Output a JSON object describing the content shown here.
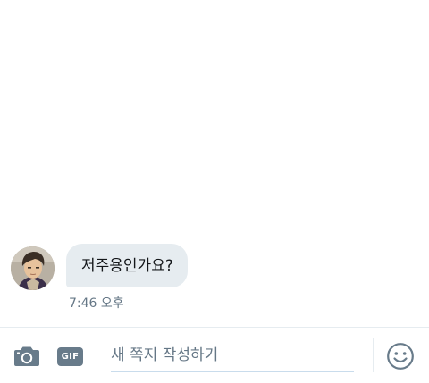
{
  "conversation": {
    "messages": [
      {
        "sender": "other",
        "text": "저주용인가요?",
        "time": "7:46 오후"
      }
    ]
  },
  "composer": {
    "placeholder": "새 쪽지 작성하기",
    "value": "",
    "camera_icon": "camera-icon",
    "gif_label": "GIF",
    "emoji_icon": "smiley-icon"
  },
  "colors": {
    "bubble_bg": "#e6ecf0",
    "icon_gray": "#657786",
    "accent_underline": "#c9dcec"
  }
}
